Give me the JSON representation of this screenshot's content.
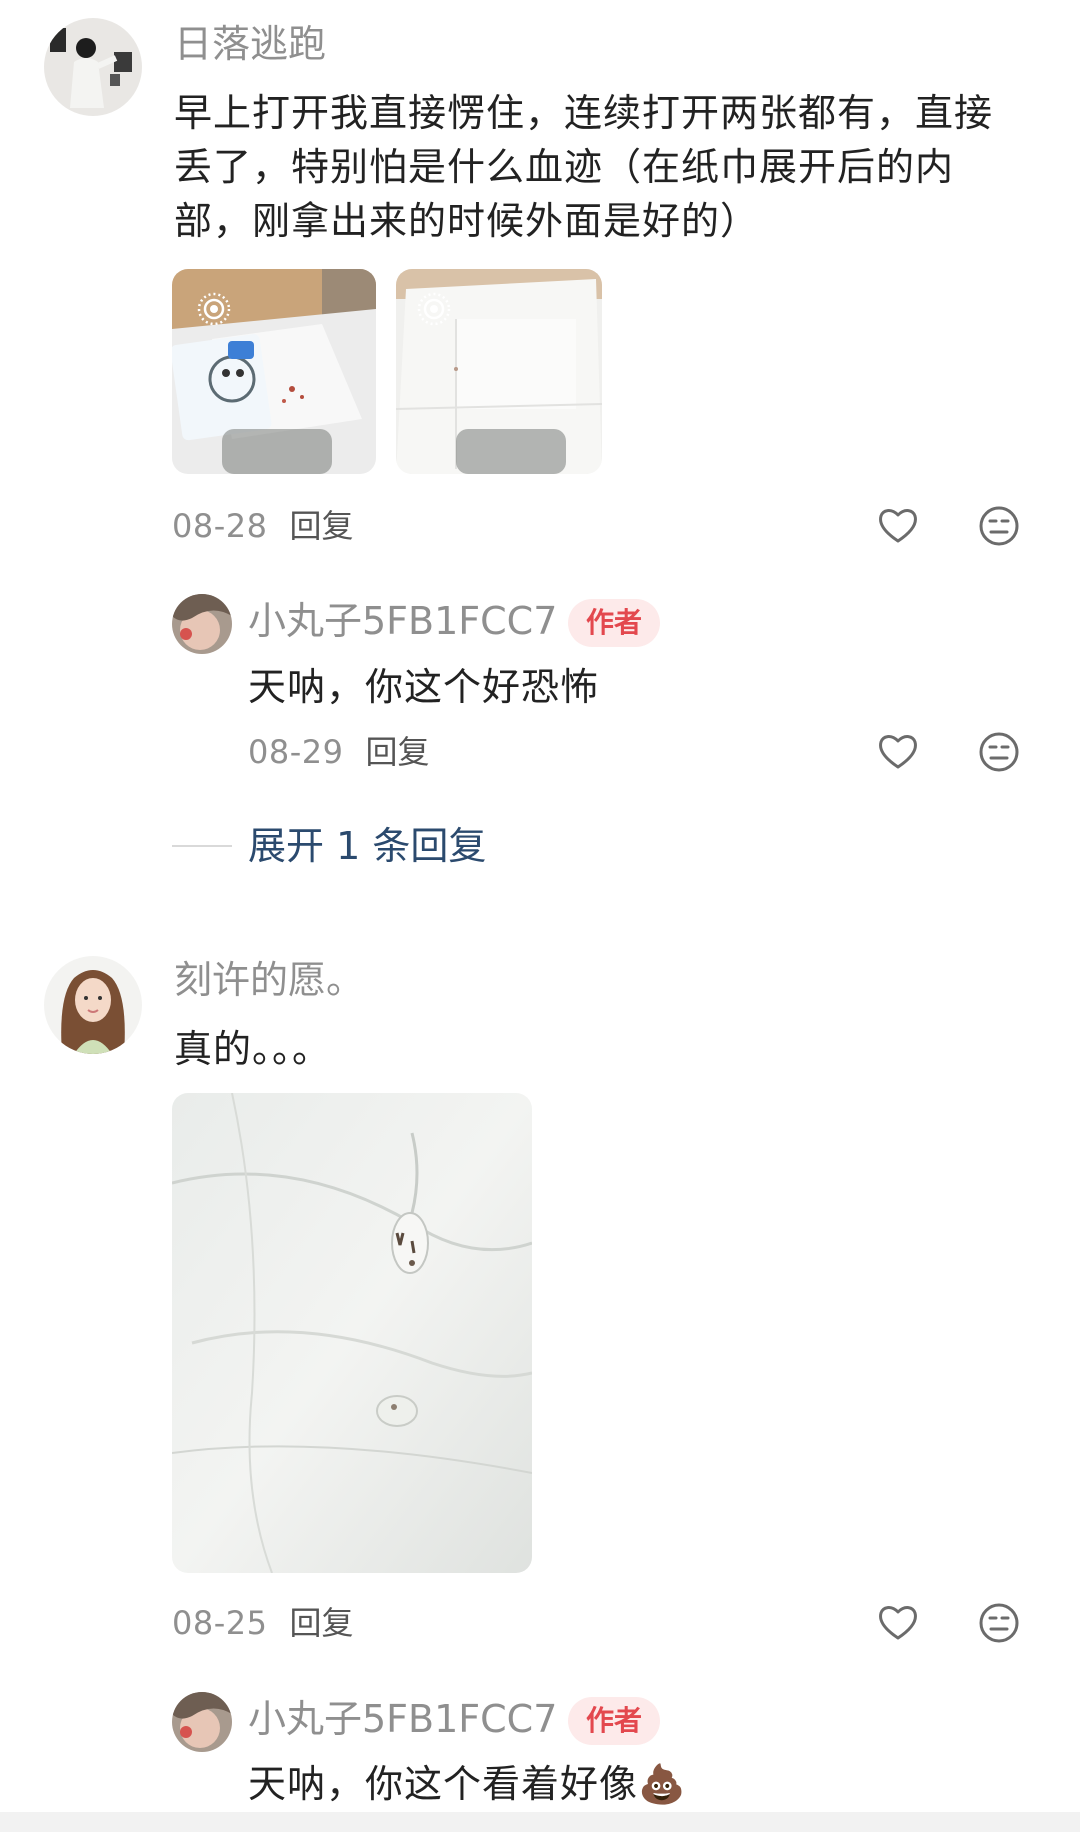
{
  "comments": [
    {
      "username": "日落逃跑",
      "text": "早上打开我直接愣住，连续打开两张都有，直接丢了，特别怕是什么血迹（在纸巾展开后的内部，刚拿出来的时候外面是好的）",
      "date": "08-28",
      "reply_label": "回复",
      "images": [
        "tissue-photo-with-package",
        "tissue-photo-unfolded"
      ],
      "replies": [
        {
          "username": "小丸子5FB1FCC7",
          "badge": "作者",
          "text": "天呐，你这个好恐怖",
          "date": "08-29",
          "reply_label": "回复"
        }
      ],
      "expand_label": "展开 1 条回复"
    },
    {
      "username": "刻许的愿。",
      "text": "真的。。。",
      "date": "08-25",
      "reply_label": "回复",
      "images": [
        "tissue-photo-closeup"
      ],
      "replies": [
        {
          "username": "小丸子5FB1FCC7",
          "badge": "作者",
          "text": "天呐，你这个看着好像💩",
          "date": "",
          "reply_label": ""
        }
      ]
    }
  ],
  "icons": {
    "like": "heart-icon",
    "dislike": "meh-face-icon",
    "live_photo": "live-photo-icon"
  },
  "colors": {
    "username": "#8f8f8f",
    "badge_bg": "#fdeaea",
    "badge_text": "#e3484e",
    "expand_link": "#2b4a6e"
  }
}
